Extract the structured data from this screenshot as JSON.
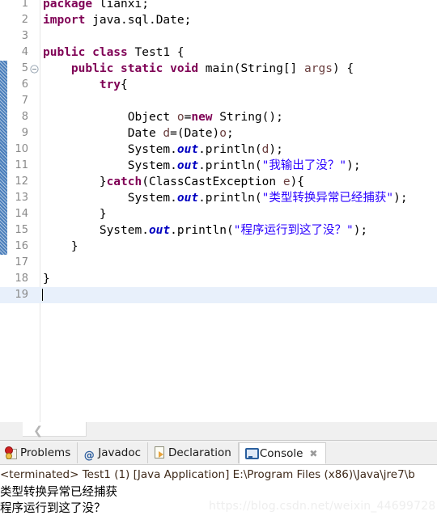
{
  "editor": {
    "name": "java-source-editor",
    "current_line": 19,
    "fold_line": 5,
    "annotation_range": {
      "from_line": 5,
      "to_line": 16
    },
    "lines": [
      {
        "num": "1",
        "segments": [
          {
            "t": "package",
            "c": "kw"
          },
          {
            "t": " lianxi;",
            "c": "plain"
          }
        ]
      },
      {
        "num": "2",
        "segments": [
          {
            "t": "import",
            "c": "kw"
          },
          {
            "t": " java.sql.Date;",
            "c": "plain"
          }
        ]
      },
      {
        "num": "3",
        "segments": []
      },
      {
        "num": "4",
        "segments": [
          {
            "t": "public class",
            "c": "kw"
          },
          {
            "t": " Test1 {",
            "c": "plain"
          }
        ]
      },
      {
        "num": "5",
        "segments": [
          {
            "t": "    ",
            "c": "plain"
          },
          {
            "t": "public static void",
            "c": "kw"
          },
          {
            "t": " main(String[] ",
            "c": "plain"
          },
          {
            "t": "args",
            "c": "loc"
          },
          {
            "t": ") {",
            "c": "plain"
          }
        ]
      },
      {
        "num": "6",
        "segments": [
          {
            "t": "        ",
            "c": "plain"
          },
          {
            "t": "try",
            "c": "kw"
          },
          {
            "t": "{",
            "c": "plain"
          }
        ]
      },
      {
        "num": "7",
        "segments": []
      },
      {
        "num": "8",
        "segments": [
          {
            "t": "            Object ",
            "c": "plain"
          },
          {
            "t": "o",
            "c": "loc"
          },
          {
            "t": "=",
            "c": "plain"
          },
          {
            "t": "new",
            "c": "kw"
          },
          {
            "t": " String();",
            "c": "plain"
          }
        ]
      },
      {
        "num": "9",
        "segments": [
          {
            "t": "            Date ",
            "c": "plain"
          },
          {
            "t": "d",
            "c": "loc"
          },
          {
            "t": "=(Date)",
            "c": "plain"
          },
          {
            "t": "o",
            "c": "loc"
          },
          {
            "t": ";",
            "c": "plain"
          }
        ]
      },
      {
        "num": "10",
        "segments": [
          {
            "t": "            System.",
            "c": "plain"
          },
          {
            "t": "out",
            "c": "fld"
          },
          {
            "t": ".println(",
            "c": "plain"
          },
          {
            "t": "d",
            "c": "loc"
          },
          {
            "t": ");",
            "c": "plain"
          }
        ]
      },
      {
        "num": "11",
        "segments": [
          {
            "t": "            System.",
            "c": "plain"
          },
          {
            "t": "out",
            "c": "fld"
          },
          {
            "t": ".println(",
            "c": "plain"
          },
          {
            "t": "\"我输出了没？\"",
            "c": "str"
          },
          {
            "t": ");",
            "c": "plain"
          }
        ]
      },
      {
        "num": "12",
        "segments": [
          {
            "t": "        }",
            "c": "plain"
          },
          {
            "t": "catch",
            "c": "kw"
          },
          {
            "t": "(ClassCastException ",
            "c": "plain"
          },
          {
            "t": "e",
            "c": "loc"
          },
          {
            "t": "){",
            "c": "plain"
          }
        ]
      },
      {
        "num": "13",
        "segments": [
          {
            "t": "            System.",
            "c": "plain"
          },
          {
            "t": "out",
            "c": "fld"
          },
          {
            "t": ".println(",
            "c": "plain"
          },
          {
            "t": "\"类型转换异常已经捕获\"",
            "c": "str"
          },
          {
            "t": ");",
            "c": "plain"
          }
        ]
      },
      {
        "num": "14",
        "segments": [
          {
            "t": "        }",
            "c": "plain"
          }
        ]
      },
      {
        "num": "15",
        "segments": [
          {
            "t": "        System.",
            "c": "plain"
          },
          {
            "t": "out",
            "c": "fld"
          },
          {
            "t": ".println(",
            "c": "plain"
          },
          {
            "t": "\"程序运行到这了没？\"",
            "c": "str"
          },
          {
            "t": ");",
            "c": "plain"
          }
        ]
      },
      {
        "num": "16",
        "segments": [
          {
            "t": "    }",
            "c": "plain"
          }
        ]
      },
      {
        "num": "17",
        "segments": []
      },
      {
        "num": "18",
        "segments": [
          {
            "t": "}",
            "c": "plain"
          }
        ]
      },
      {
        "num": "19",
        "segments": []
      }
    ]
  },
  "bottom_panel": {
    "tabs": [
      {
        "label": "Problems",
        "icon": "problems-marker-icon",
        "active": false,
        "closable": false
      },
      {
        "label": "Javadoc",
        "icon": "at-sign-icon",
        "active": false,
        "closable": false
      },
      {
        "label": "Declaration",
        "icon": "declaration-page-icon",
        "active": false,
        "closable": false
      },
      {
        "label": "Console",
        "icon": "console-monitor-icon",
        "active": true,
        "closable": true,
        "close_glyph": "✖"
      }
    ],
    "console": {
      "terminated_line": "<terminated> Test1 (1) [Java Application] E:\\Program Files (x86)\\Java\\jre7\\b",
      "output_lines": [
        "类型转换异常已经捕获",
        "程序运行到这了没？"
      ]
    }
  },
  "watermark": {
    "text": "https://blog.csdn.net/weixin_44699728"
  },
  "colors": {
    "keyword": "#7f0055",
    "string": "#2a00ff",
    "static_field": "#0000c0",
    "local_var": "#6a3e3e",
    "current_line_bg": "#e8f0fb",
    "annotation_bar": "#4a7ebb",
    "gutter_text": "#8a8a8a",
    "panel_bg": "#f0f0f0",
    "terminated_text": "#3f2a1a"
  }
}
